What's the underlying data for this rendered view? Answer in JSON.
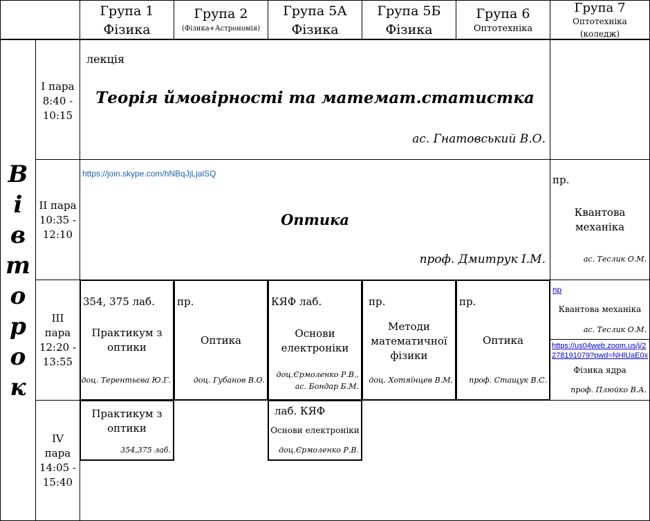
{
  "day": [
    "В",
    "і",
    "в",
    "т",
    "о",
    "р",
    "о",
    "к"
  ],
  "groups": [
    {
      "name": "Група 1",
      "spec": "Фізика"
    },
    {
      "name": "Група 2",
      "spec": "(Фізика+Астрономія)"
    },
    {
      "name": "Група 5А",
      "spec": "Фізика"
    },
    {
      "name": "Група 5Б",
      "spec": "Фізика"
    },
    {
      "name": "Група 6",
      "spec": "Оптотехніка"
    },
    {
      "name": "Група 7",
      "spec": "Оптотехніка",
      "spec2": "(коледж)"
    }
  ],
  "pairs": [
    {
      "n": "І пара",
      "start": "8:40 -",
      "end": "10:15"
    },
    {
      "n": "ІІ пара",
      "start": "10:35 -",
      "end": "12:10"
    },
    {
      "n": "ІІІ",
      "n2": "пара",
      "start": "12:20 -",
      "end": "13:55"
    },
    {
      "n": "IV",
      "n2": "пара",
      "start": "14:05 -",
      "end": "15:40"
    }
  ],
  "p1": {
    "type": "лекція",
    "subject": "Теорія ймовірності та математ.статистка",
    "teacher": "ас. Гнатовський В.О."
  },
  "p2": {
    "link": "https://join.skype.com/hNBqJjLjalSQ",
    "subject": "Оптика",
    "teacher": "проф. Дмитрук І.М."
  },
  "p2g7": {
    "type": "пр.",
    "subject1": "Квантова",
    "subject2": "механіка",
    "teacher": "ас. Теслик О.М."
  },
  "p3": [
    {
      "type": "354, 375 лаб.",
      "subject1": "Практикум з",
      "subject2": "оптики",
      "teacher": "доц. Терентьєва Ю.Г."
    },
    {
      "type": "пр.",
      "subject1": "Оптика",
      "teacher": "доц. Губанов В.О."
    },
    {
      "type": "КЯФ лаб.",
      "subject1": "Основи",
      "subject2": "електроніки",
      "teacher": "доц.Єрмоленко Р.В.,",
      "teacher2": "ас. Бондар Б.М."
    },
    {
      "type": "пр.",
      "subject1": "Методи",
      "subject2": "математичної",
      "subject3": "фізики",
      "teacher": "доц. Хотяїнцев В.М."
    },
    {
      "type": "пр.",
      "subject1": "Оптика",
      "teacher": "проф. Стащук В.С."
    }
  ],
  "p3g7a": {
    "type": "пр",
    "subject": "Квантова механіка",
    "teacher": "ас. Теслик О.М."
  },
  "p3g7b": {
    "link1": "https://us04web.zoom.us/j/2",
    "link2": "278191079?pwd=NHlUaE0x",
    "subject": "Фізика ядра",
    "teacher": "проф. Плюйко В.А."
  },
  "p4g1": {
    "subject1": "Практикум з",
    "subject2": "оптики",
    "room": "354,375 лаб."
  },
  "p4g5a": {
    "type": "лаб. КЯФ",
    "subject": "Основи електроніки",
    "teacher": "доц.Єрмоленко Р.В."
  }
}
